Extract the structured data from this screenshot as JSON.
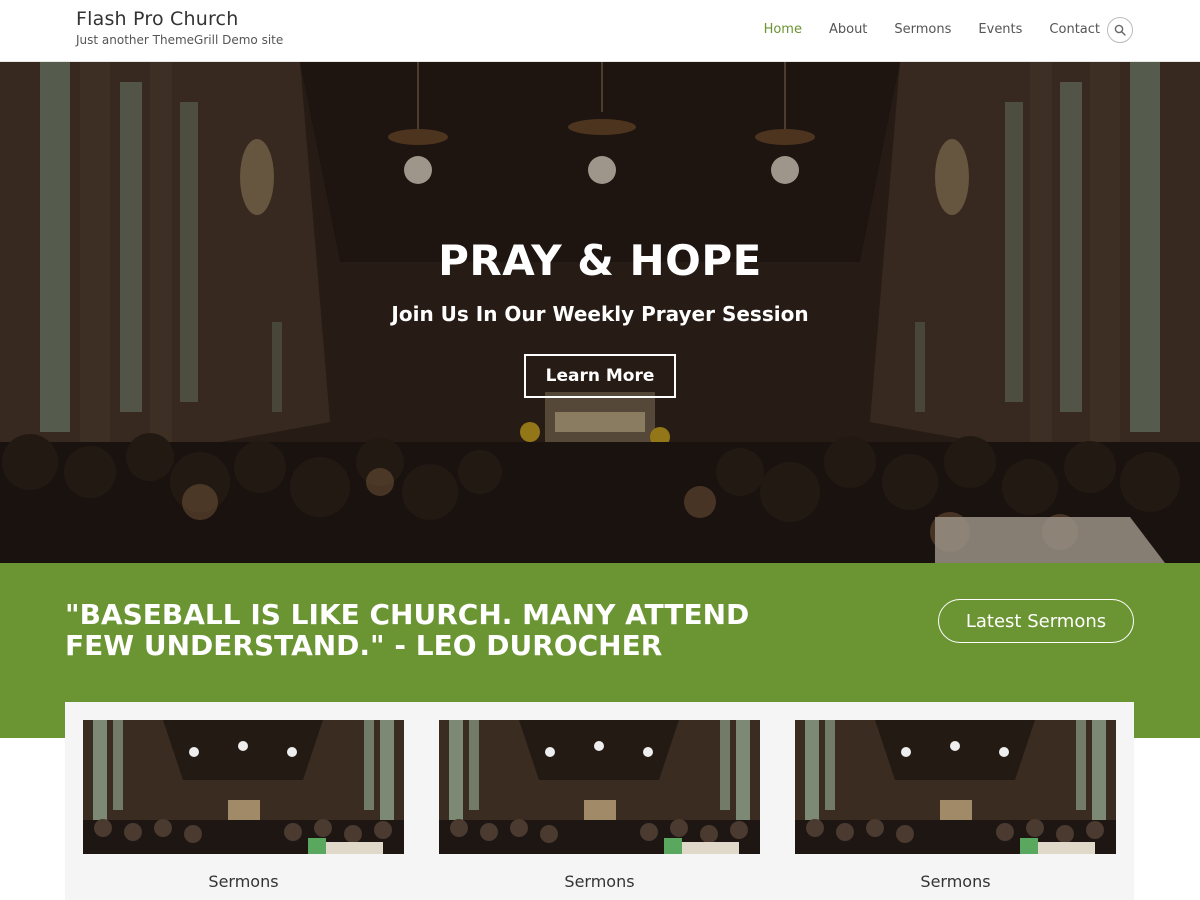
{
  "site": {
    "title": "Flash Pro Church",
    "tagline": "Just another ThemeGrill Demo site"
  },
  "nav": {
    "items": [
      {
        "label": "Home",
        "active": true
      },
      {
        "label": "About",
        "active": false
      },
      {
        "label": "Sermons",
        "active": false
      },
      {
        "label": "Events",
        "active": false
      },
      {
        "label": "Contact",
        "active": false
      }
    ],
    "search_icon": "search-icon"
  },
  "hero": {
    "title": "PRAY & HOPE",
    "subtitle": "Join Us In Our Weekly Prayer Session",
    "button_label": "Learn More"
  },
  "callout": {
    "quote": "\"BASEBALL IS LIKE CHURCH. MANY ATTEND FEW UNDERSTAND.\" - LEO DUROCHER",
    "button_label": "Latest Sermons"
  },
  "cards": [
    {
      "label": "Sermons"
    },
    {
      "label": "Sermons"
    },
    {
      "label": "Sermons"
    }
  ],
  "colors": {
    "accent": "#6b9432",
    "text": "#333333",
    "hero_dark": "#2a1e17"
  }
}
